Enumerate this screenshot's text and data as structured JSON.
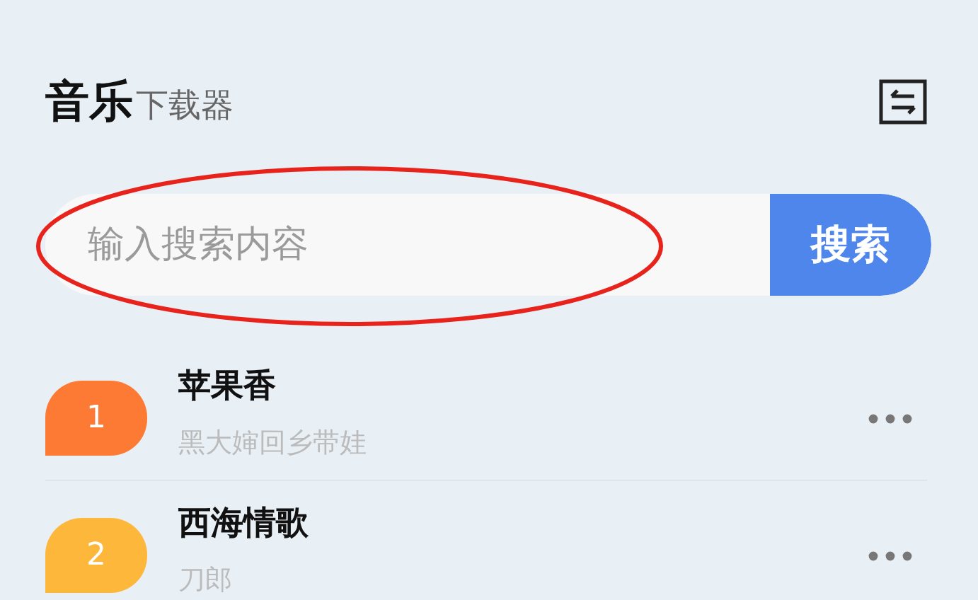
{
  "header": {
    "title": "音乐",
    "subtitle": "下载器"
  },
  "search": {
    "placeholder": "输入搜索内容",
    "button": "搜索"
  },
  "songs": [
    {
      "rank": "1",
      "title": "苹果香",
      "artist": "黑大婶回乡带娃",
      "color": "#fd7a35"
    },
    {
      "rank": "2",
      "title": "西海情歌",
      "artist": "刀郎",
      "color": "#fdb73a"
    }
  ]
}
